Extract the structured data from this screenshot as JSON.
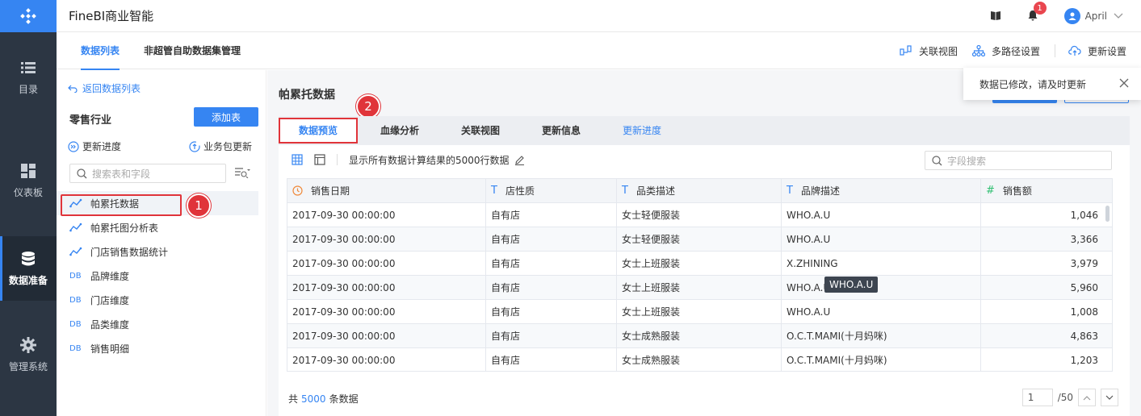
{
  "app": {
    "title": "FineBI商业智能"
  },
  "leftnav": {
    "items": [
      {
        "label": "目录",
        "icon": "list-icon"
      },
      {
        "label": "仪表板",
        "icon": "dashboard-icon"
      },
      {
        "label": "数据准备",
        "icon": "database-icon",
        "active": true
      },
      {
        "label": "管理系统",
        "icon": "gear-icon"
      }
    ]
  },
  "topbar": {
    "notification_count": "1",
    "user_name": "April"
  },
  "subbar": {
    "tabs": [
      {
        "label": "数据列表"
      },
      {
        "label": "非超管自助数据集管理"
      }
    ],
    "actions": [
      {
        "label": "关联视图"
      },
      {
        "label": "多路径设置"
      },
      {
        "label": "更新设置"
      }
    ]
  },
  "leftpanel": {
    "back_label": "返回数据列表",
    "package_title": "零售行业",
    "add_table_label": "添加表",
    "update_progress_label": "更新进度",
    "package_update_label": "业务包更新",
    "search_placeholder": "搜索表和字段",
    "items": [
      {
        "label": "帕累托数据",
        "type": "self-service",
        "selected": true
      },
      {
        "label": "帕累托图分析表",
        "type": "self-service"
      },
      {
        "label": "门店销售数据统计",
        "type": "self-service"
      },
      {
        "label": "品牌维度",
        "type": "DB"
      },
      {
        "label": "门店维度",
        "type": "DB"
      },
      {
        "label": "品类维度",
        "type": "DB"
      },
      {
        "label": "销售明细",
        "type": "DB"
      }
    ],
    "callout_1": "1"
  },
  "main": {
    "table_title": "帕累托数据",
    "callout_2": "2",
    "tabs": [
      {
        "label": "数据预览"
      },
      {
        "label": "血缘分析"
      },
      {
        "label": "关联视图"
      },
      {
        "label": "更新信息"
      },
      {
        "label": "更新进度"
      }
    ],
    "preview_note": "显示所有数据计算结果的5000行数据",
    "field_search_placeholder": "字段搜索",
    "columns": [
      {
        "label": "销售日期",
        "type": "date"
      },
      {
        "label": "店性质",
        "type": "T"
      },
      {
        "label": "品类描述",
        "type": "T"
      },
      {
        "label": "品牌描述",
        "type": "T"
      },
      {
        "label": "销售额",
        "type": "#"
      }
    ],
    "type_symbols": {
      "text": "T",
      "number": "#"
    },
    "rows": [
      [
        "2017-09-30 00:00:00",
        "自有店",
        "女士轻便服装",
        "WHO.A.U",
        "1,046"
      ],
      [
        "2017-09-30 00:00:00",
        "自有店",
        "女士轻便服装",
        "WHO.A.U",
        "3,366"
      ],
      [
        "2017-09-30 00:00:00",
        "自有店",
        "女士上班服装",
        "X.ZHINING",
        "3,979"
      ],
      [
        "2017-09-30 00:00:00",
        "自有店",
        "女士上班服装",
        "WHO.A.U",
        "5,960"
      ],
      [
        "2017-09-30 00:00:00",
        "自有店",
        "女士上班服装",
        "WHO.A.U",
        "1,008"
      ],
      [
        "2017-09-30 00:00:00",
        "自有店",
        "女士成熟服装",
        "O.C.T.MAMI(十月妈咪)",
        "4,863"
      ],
      [
        "2017-09-30 00:00:00",
        "自有店",
        "女士成熟服装",
        "O.C.T.MAMI(十月妈咪)",
        "1,203"
      ]
    ],
    "tooltip": "WHO.A.U",
    "footer": {
      "prefix": "共",
      "count": "5000",
      "suffix": "条数据"
    },
    "pager": {
      "current": "1",
      "total": "/50"
    }
  },
  "toast": {
    "message": "数据已修改，请及时更新"
  },
  "colors": {
    "accent": "#3685f2",
    "nav_bg": "#2c3643",
    "highlight": "#e0343a"
  }
}
